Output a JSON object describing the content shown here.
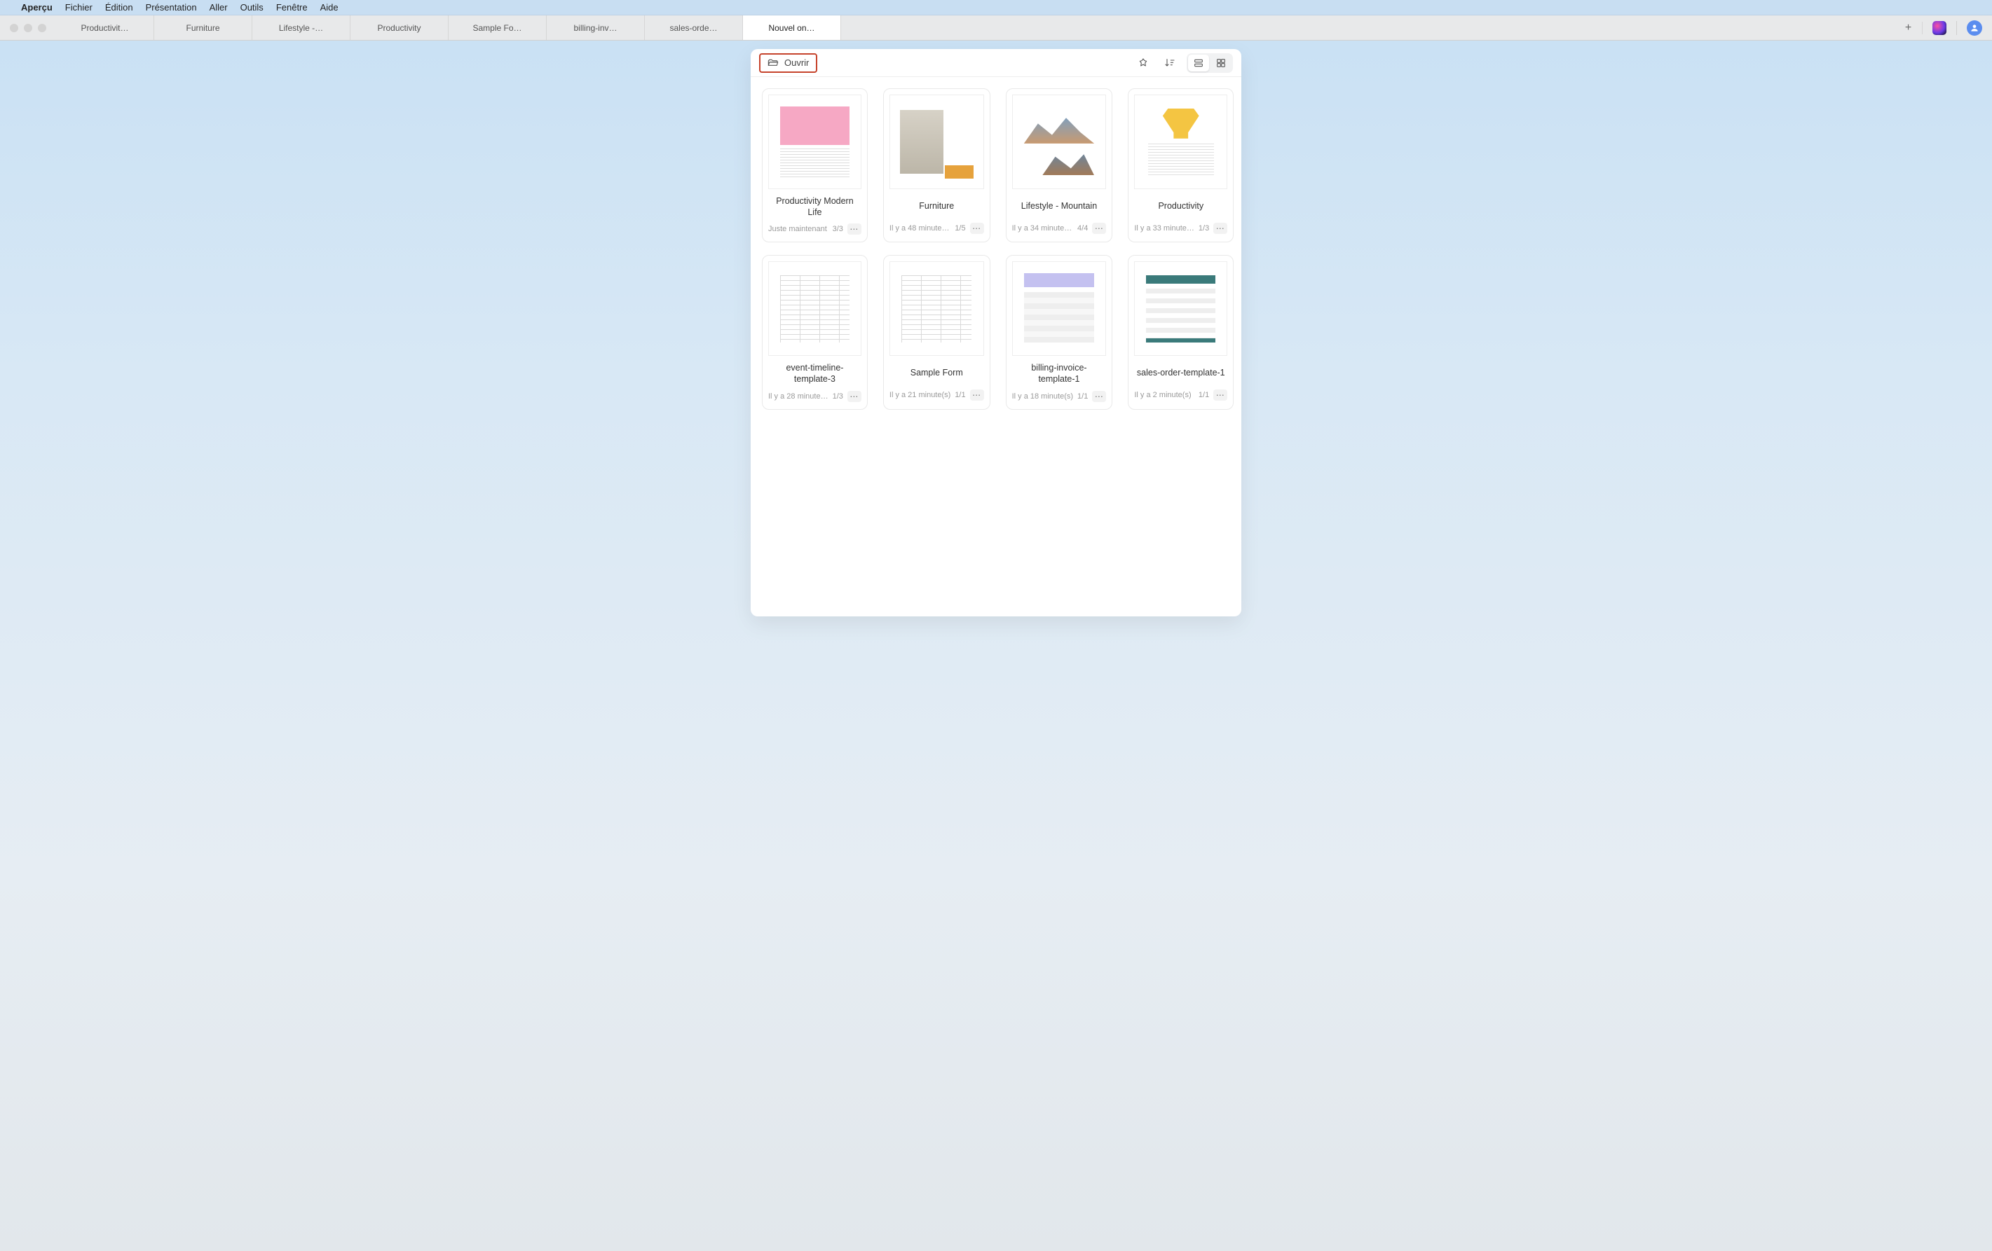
{
  "menubar": {
    "app": "Aperçu",
    "items": [
      "Fichier",
      "Édition",
      "Présentation",
      "Aller",
      "Outils",
      "Fenêtre",
      "Aide"
    ]
  },
  "tabs": [
    {
      "label": "Productivit…",
      "active": false
    },
    {
      "label": "Furniture",
      "active": false
    },
    {
      "label": "Lifestyle -…",
      "active": false
    },
    {
      "label": "Productivity",
      "active": false
    },
    {
      "label": "Sample Fo…",
      "active": false
    },
    {
      "label": "billing-inv…",
      "active": false
    },
    {
      "label": "sales-orde…",
      "active": false
    },
    {
      "label": "Nouvel on…",
      "active": true
    }
  ],
  "toolbar": {
    "open_label": "Ouvrir"
  },
  "documents": [
    {
      "title": "Productivity Modern Life",
      "time": "Juste maintenant",
      "pages": "3/3",
      "thumb": "pink-doc"
    },
    {
      "title": "Furniture",
      "time": "Il y a 48 minute…",
      "pages": "1/5",
      "thumb": "chair-doc"
    },
    {
      "title": "Lifestyle - Mountain",
      "time": "Il y a 34 minute…",
      "pages": "4/4",
      "thumb": "mountain-doc"
    },
    {
      "title": "Productivity",
      "time": "Il y a 33 minute…",
      "pages": "1/3",
      "thumb": "trophy-doc"
    },
    {
      "title": "event-timeline-template-3",
      "time": "Il y a 28 minute…",
      "pages": "1/3",
      "thumb": "table-doc"
    },
    {
      "title": "Sample Form",
      "time": "Il y a 21 minute(s)",
      "pages": "1/1",
      "thumb": "table-doc"
    },
    {
      "title": "billing-invoice-template-1",
      "time": "Il y a 18 minute(s)",
      "pages": "1/1",
      "thumb": "invoice-doc"
    },
    {
      "title": "sales-order-template-1",
      "time": "Il y a 2 minute(s)",
      "pages": "1/1",
      "thumb": "sales-doc"
    }
  ]
}
